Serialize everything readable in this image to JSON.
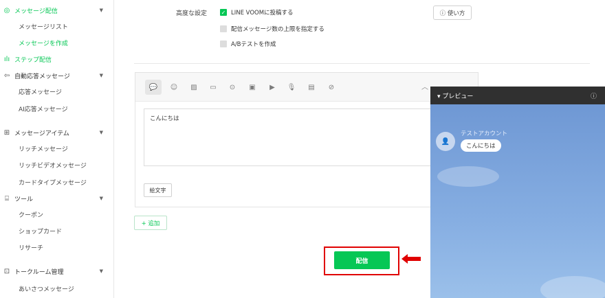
{
  "sidebar": {
    "sections": [
      {
        "label": "メッセージ配信",
        "icon": "broadcast-icon",
        "expanded": true,
        "active": true,
        "items": [
          {
            "label": "メッセージリスト",
            "active": false
          },
          {
            "label": "メッセージを作成",
            "active": true
          }
        ]
      },
      {
        "label": "ステップ配信",
        "icon": "step-icon",
        "expanded": false,
        "active": true,
        "items": []
      },
      {
        "label": "自動応答メッセージ",
        "icon": "auto-reply-icon",
        "expanded": true,
        "active": false,
        "items": [
          {
            "label": "応答メッセージ"
          },
          {
            "label": "AI応答メッセージ"
          }
        ]
      },
      {
        "label": "メッセージアイテム",
        "icon": "message-item-icon",
        "expanded": true,
        "active": false,
        "items": [
          {
            "label": "リッチメッセージ"
          },
          {
            "label": "リッチビデオメッセージ"
          },
          {
            "label": "カードタイプメッセージ"
          }
        ]
      },
      {
        "label": "ツール",
        "icon": "tools-icon",
        "expanded": true,
        "active": false,
        "items": [
          {
            "label": "クーポン"
          },
          {
            "label": "ショップカード"
          },
          {
            "label": "リサーチ"
          }
        ]
      },
      {
        "label": "トークルーム管理",
        "icon": "talkroom-icon",
        "expanded": true,
        "active": false,
        "items": [
          {
            "label": "あいさつメッセージ"
          }
        ]
      }
    ]
  },
  "advanced": {
    "label": "高度な設定",
    "options": [
      {
        "label": "LINE VOOMに投稿する",
        "checked": true
      },
      {
        "label": "配信メッセージ数の上限を指定する",
        "checked": false
      },
      {
        "label": "A/Bテストを作成",
        "checked": false
      }
    ],
    "howto_label": "ⓘ 使い方"
  },
  "editor": {
    "toolbar_icons": [
      "speech-bubble-icon",
      "sticker-icon",
      "image-icon",
      "coupon-icon",
      "rich-message-icon",
      "rich-video-icon",
      "video-icon",
      "audio-icon",
      "research-icon",
      "card-message-icon"
    ],
    "message_text": "こんにちは",
    "emoji_button": "絵文字"
  },
  "add_button": "+ 追加",
  "send_button": "配信",
  "preview": {
    "title": "▾ プレビュー",
    "account_name": "テストアカウント",
    "bubble_text": "こんにちは"
  },
  "colors": {
    "brand": "#06c755",
    "highlight": "#e00000",
    "preview_bg": "#7aa2d9"
  }
}
